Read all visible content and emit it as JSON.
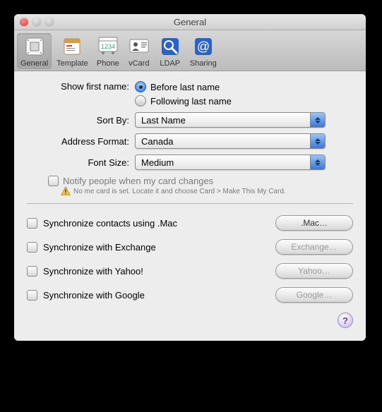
{
  "window": {
    "title": "General"
  },
  "toolbar": {
    "items": [
      {
        "label": "General"
      },
      {
        "label": "Template"
      },
      {
        "label": "Phone"
      },
      {
        "label": "vCard"
      },
      {
        "label": "LDAP"
      },
      {
        "label": "Sharing"
      }
    ]
  },
  "first_name": {
    "label": "Show first name:",
    "before": "Before last name",
    "following": "Following last name",
    "selected": "before"
  },
  "sort_by": {
    "label": "Sort By:",
    "value": "Last Name"
  },
  "address_format": {
    "label": "Address Format:",
    "value": "Canada"
  },
  "font_size": {
    "label": "Font Size:",
    "value": "Medium"
  },
  "notify": {
    "label": "Notify people when my card changes",
    "hint": "No me card is set. Locate it and choose Card > Make This My Card."
  },
  "sync": {
    "mac": {
      "label": "Synchronize contacts using .Mac",
      "button": ".Mac…"
    },
    "exchange": {
      "label": "Synchronize with Exchange",
      "button": "Exchange…"
    },
    "yahoo": {
      "label": "Synchronize with Yahoo!",
      "button": "Yahoo…"
    },
    "google": {
      "label": "Synchronize with Google",
      "button": "Google…"
    }
  },
  "help": {
    "label": "?"
  }
}
